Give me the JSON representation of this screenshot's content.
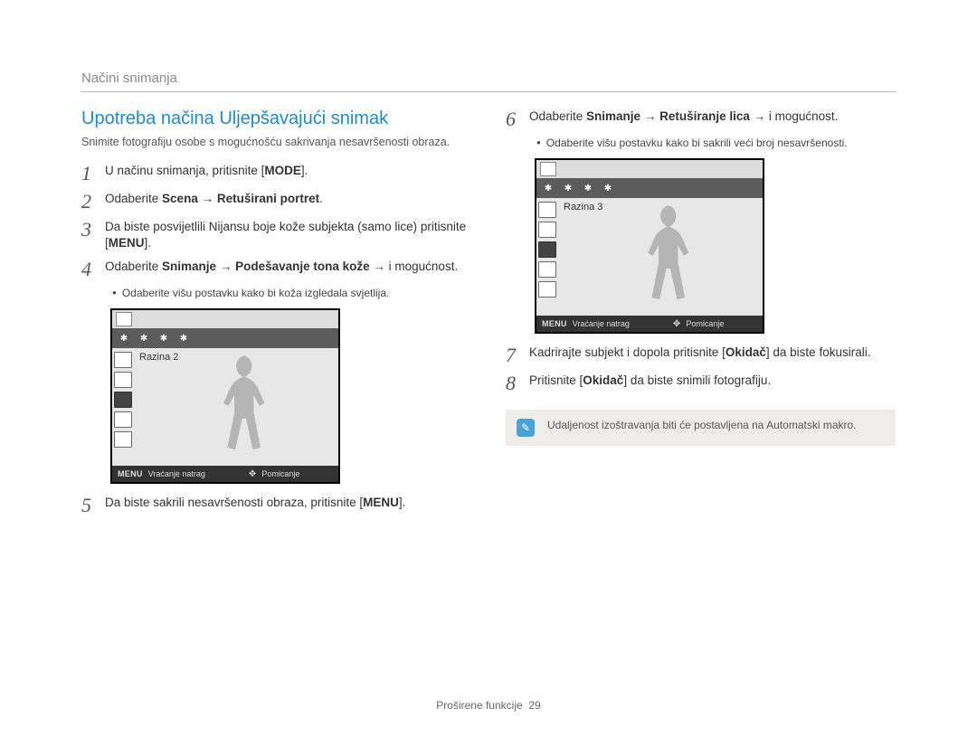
{
  "header": {
    "section": "Načini snimanja"
  },
  "title": "Upotreba načina Uljepšavajući snimak",
  "intro": "Snimite fotografiju osobe s mogućnošću sakrivanja nesavršenosti obraza.",
  "left": {
    "s1": {
      "num": "1",
      "p1": "U načinu snimanja, pritisnite [",
      "b1": "MODE",
      "p2": "]."
    },
    "s2": {
      "num": "2",
      "p1": "Odaberite ",
      "b1": "Scena",
      "p2": " → ",
      "b2": "Retuširani portret",
      "p3": "."
    },
    "s3": {
      "num": "3",
      "p1": "Da biste posvijetlili Nijansu boje kože subjekta (samo lice) pritisnite [",
      "b1": "MENU",
      "p2": "]."
    },
    "s4": {
      "num": "4",
      "p1": "Odaberite ",
      "b1": "Snimanje",
      "p2": " → ",
      "b2": "Podešavanje tona kože",
      "p3": " → i mogućnost."
    },
    "b1": "Odaberite višu postavku kako bi koža izgledala svjetlija.",
    "shot1": {
      "level": "Razina 2",
      "menu": "MENU",
      "back": "Vraćanje natrag",
      "move": "Pomicanje"
    },
    "s5": {
      "num": "5",
      "p1": "Da biste sakrili nesavršenosti obraza, pritisnite [",
      "b1": "MENU",
      "p2": "]."
    }
  },
  "right": {
    "s6": {
      "num": "6",
      "p1": "Odaberite ",
      "b1": "Snimanje",
      "p2": " → ",
      "b2": "Retuširanje lica",
      "p3": " → i mogućnost."
    },
    "b1": "Odaberite višu postavku kako bi sakrili veći broj nesavršenosti.",
    "shot2": {
      "level": "Razina 3",
      "menu": "MENU",
      "back": "Vraćanje natrag",
      "move": "Pomicanje"
    },
    "s7": {
      "num": "7",
      "p1": "Kadrirajte subjekt i dopola pritisnite [",
      "b1": "Okidač",
      "p2": "] da biste fokusirali."
    },
    "s8": {
      "num": "8",
      "p1": "Pritisnite [",
      "b1": "Okidač",
      "p2": "] da biste snimili fotografiju."
    },
    "note": "Udaljenost izoštravanja biti će postavljena na Automatski makro."
  },
  "footer": {
    "label": "Proširene funkcije",
    "page": "29"
  },
  "icons": {
    "band1": "✱",
    "band2": "✱",
    "band3": "✱",
    "band4": "✱",
    "note": "✎",
    "nav": "✥"
  }
}
